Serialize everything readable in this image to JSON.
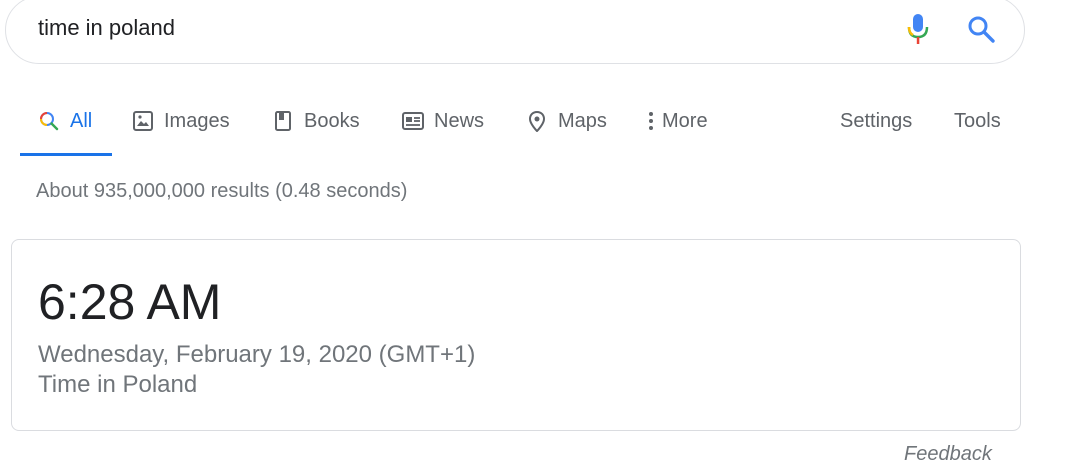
{
  "search": {
    "query": "time in poland",
    "mic_icon": "microphone-icon",
    "search_icon": "search-icon"
  },
  "tabs": [
    {
      "label": "All",
      "icon": "search-icon",
      "active": true
    },
    {
      "label": "Images",
      "icon": "image-icon"
    },
    {
      "label": "Books",
      "icon": "book-icon"
    },
    {
      "label": "News",
      "icon": "news-icon"
    },
    {
      "label": "Maps",
      "icon": "map-pin-icon"
    },
    {
      "label": "More",
      "icon": "more-vertical-icon"
    }
  ],
  "tools": {
    "settings_label": "Settings",
    "tools_label": "Tools"
  },
  "result_stats": "About 935,000,000 results (0.48 seconds)",
  "time_card": {
    "time": "6:28 AM",
    "date": "Wednesday, February 19, 2020 (GMT+1)",
    "location": "Time in Poland"
  },
  "feedback_label": "Feedback",
  "colors": {
    "accent": "#1a73e8",
    "muted_text": "#70757a",
    "text": "#202124",
    "border": "#dadce0"
  }
}
